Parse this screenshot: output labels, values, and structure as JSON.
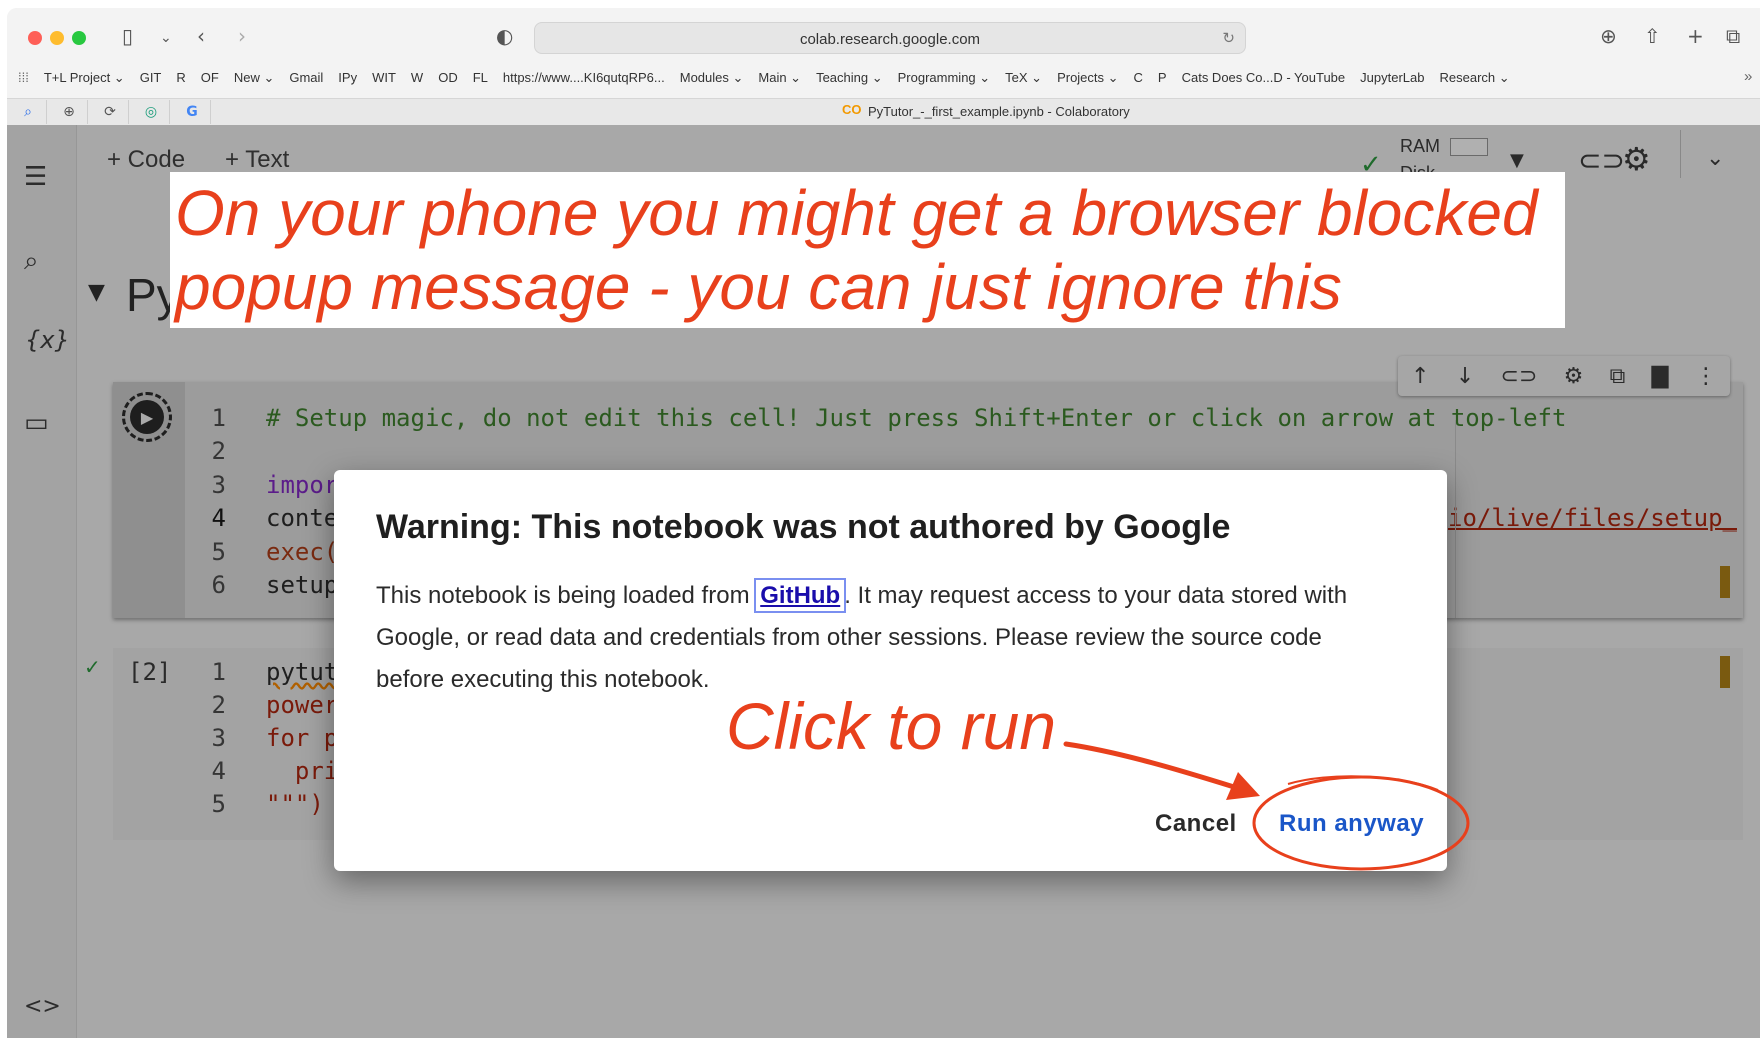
{
  "browser": {
    "url": "colab.research.google.com",
    "tab_title": "PyTutor_-_first_example.ipynb - Colaboratory",
    "tab_logo": "CO",
    "bookmarks": [
      "T+L Project ⌄",
      "GIT",
      "R",
      "OF",
      "New ⌄",
      "Gmail",
      "IPy",
      "WIT",
      "W",
      "OD",
      "FL",
      "https://www....KI6qutqRP6...",
      "Modules ⌄",
      "Main ⌄",
      "Teaching ⌄",
      "Programming ⌄",
      "TeX ⌄",
      "Projects ⌄",
      "C",
      "P",
      "Cats Does Co...D - YouTube",
      "JupyterLab",
      "Research ⌄"
    ],
    "traffic_colors": [
      "#fe5f57",
      "#febc2e",
      "#28c840"
    ]
  },
  "colab": {
    "toolbar": {
      "code_label": "+ Code",
      "text_label": "+ Text",
      "ram_label": "RAM",
      "disk_label": "Disk"
    },
    "heading_partial": "Py",
    "cell1": {
      "line_numbers": [
        "1",
        "2",
        "3",
        "4",
        "5",
        "6"
      ],
      "lines": [
        "# Setup magic, do not edit this cell! Just press Shift+Enter or click on arrow at top-left",
        "",
        "impor",
        "conte",
        "exec(",
        "setup"
      ],
      "overflow_text": "io/live/files/setup_"
    },
    "cell2": {
      "exec_count": "[2]",
      "line_numbers": [
        "1",
        "2",
        "3",
        "4",
        "5"
      ],
      "lines": [
        "pytut",
        "power",
        "for p",
        "  pri",
        "\"\"\")"
      ]
    }
  },
  "annotation": {
    "line1": "On your phone you might get a browser blocked",
    "line2": "popup message - you can just ignore this",
    "click": "Click to run",
    "color": "#e8401c"
  },
  "dialog": {
    "title": "Warning: This notebook was not authored by Google",
    "body_before": "This notebook is being loaded from ",
    "link": "GitHub",
    "body_after": ". It may request access to your data stored with Google, or read data and credentials from other sessions. Please review the source code before executing this notebook.",
    "cancel_label": "Cancel",
    "run_label": "Run anyway",
    "run_color": "#1a56c8"
  }
}
